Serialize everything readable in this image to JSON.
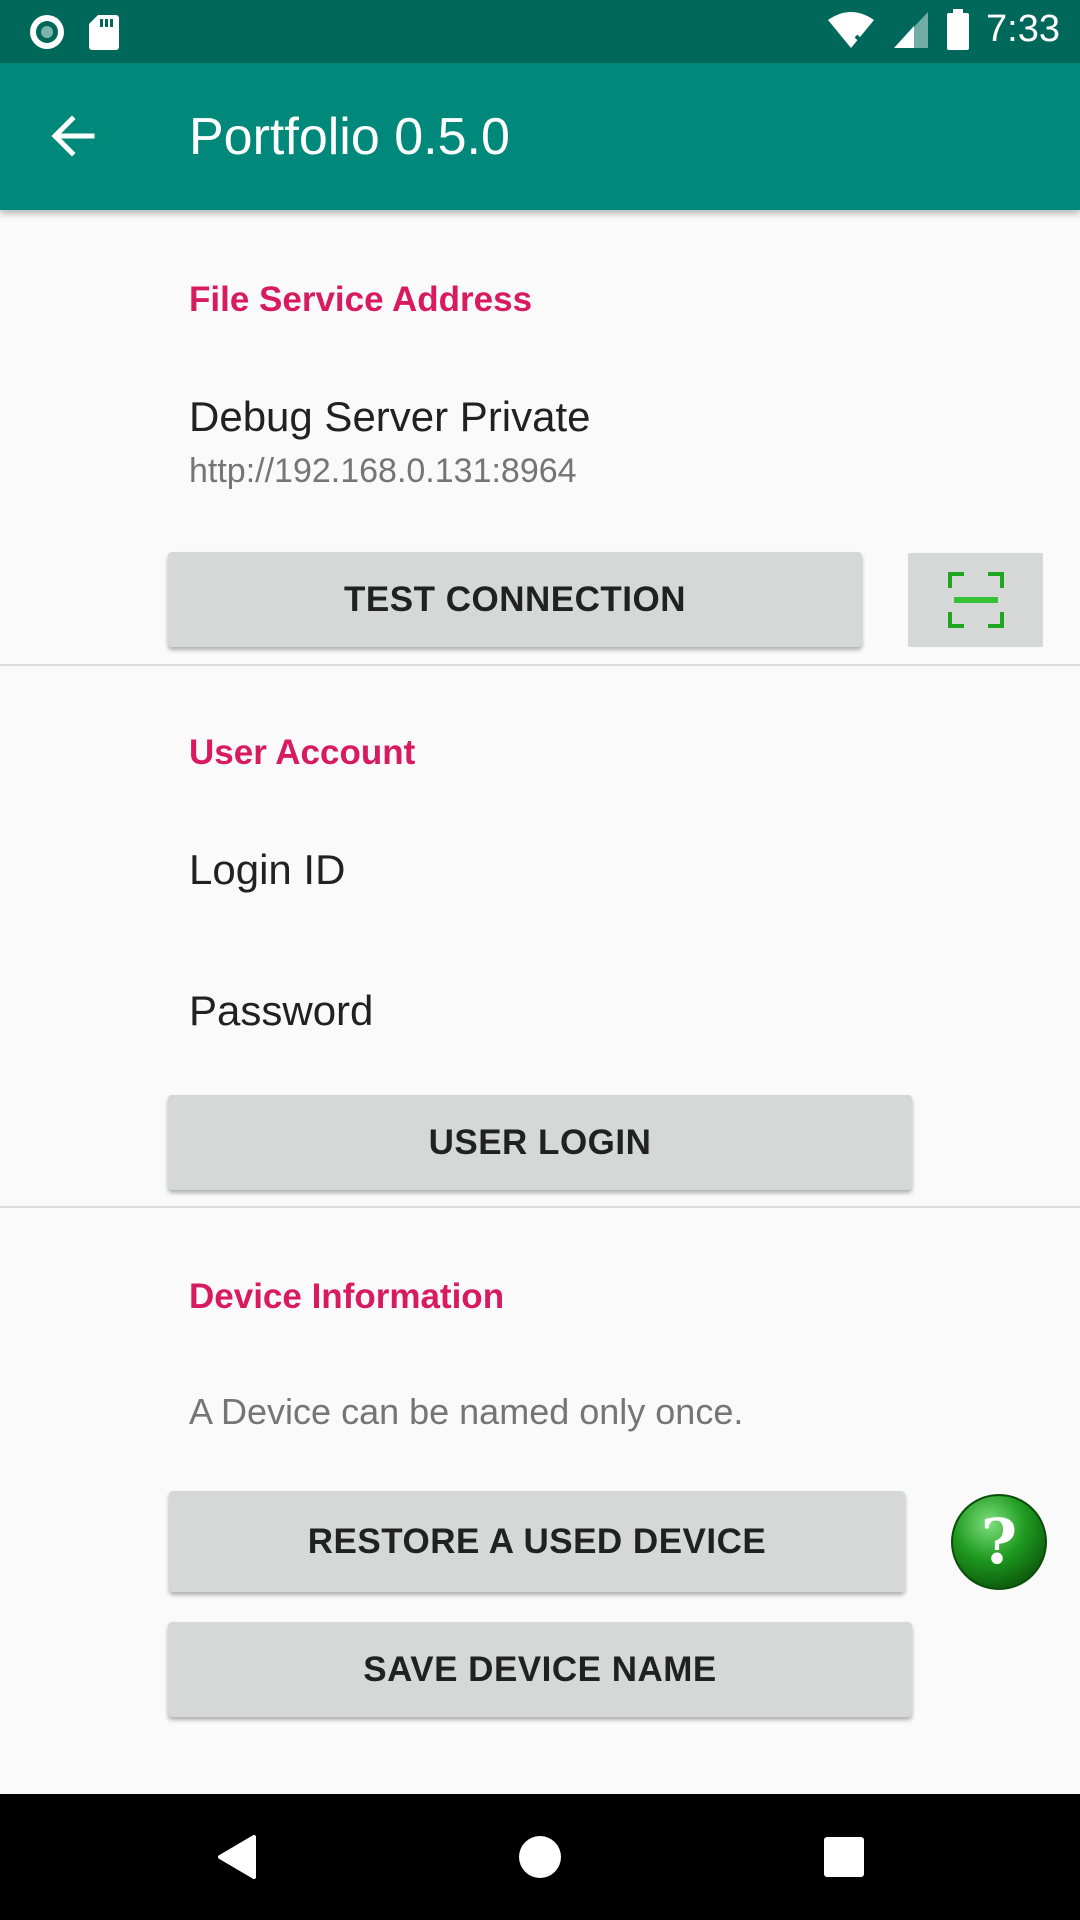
{
  "status_bar": {
    "time": "7:33",
    "left_icons": [
      "record-icon",
      "sd-card-icon"
    ],
    "right_icons": [
      "wifi-icon",
      "signal-icon",
      "battery-icon"
    ]
  },
  "app_bar": {
    "title": "Portfolio 0.5.0",
    "color": "#00897b"
  },
  "file_service": {
    "section_title": "File Service Address",
    "server_name": "Debug Server Private",
    "server_address": "http://192.168.0.131:8964",
    "test_button": "TEST CONNECTION",
    "scan_icon": "qr-scan-icon"
  },
  "user_account": {
    "section_title": "User Account",
    "login_id_label": "Login ID",
    "password_label": "Password",
    "login_button": "USER LOGIN"
  },
  "device_info": {
    "section_title": "Device Information",
    "note": "A Device can be named only once.",
    "restore_button": "RESTORE A USED DEVICE",
    "save_button": "SAVE DEVICE NAME",
    "help_icon": "help-question-icon"
  },
  "nav_bar": {
    "buttons": [
      "back-triangle-icon",
      "home-circle-icon",
      "recents-square-icon"
    ]
  },
  "colors": {
    "accent": "#d81b60",
    "primary": "#00897b",
    "primary_dark": "#00675b"
  }
}
